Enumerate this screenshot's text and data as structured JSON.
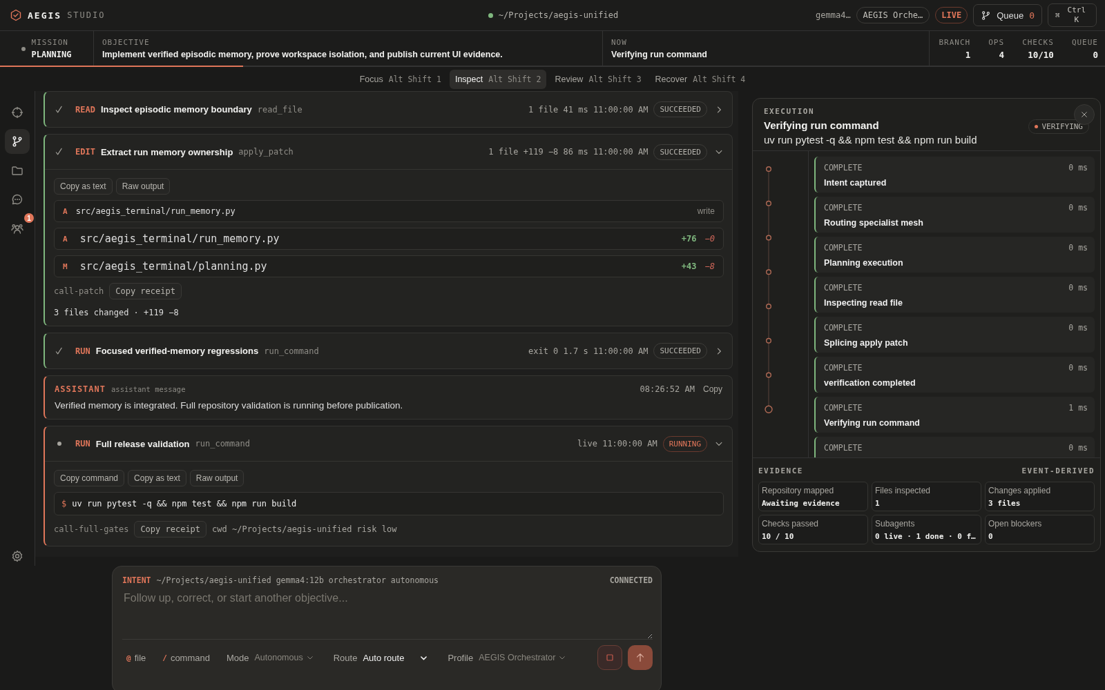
{
  "app": {
    "name": "AEGIS",
    "edition": "STUDIO"
  },
  "workspace": {
    "path": "~/Projects/aegis-unified"
  },
  "header_right": {
    "model": "gemma4…",
    "profile": "AEGIS Orche…",
    "live": "LIVE",
    "queue": {
      "label": "Queue",
      "count": "0"
    },
    "shortcut": {
      "symbol": "⌘",
      "keys": "Ctrl K"
    }
  },
  "mission_bar": {
    "mission_label": "MISSION",
    "mission": "PLANNING",
    "objective_label": "OBJECTIVE",
    "objective": "Implement verified episodic memory, prove workspace isolation, and publish current UI evidence.",
    "now_label": "NOW",
    "now": "Verifying run command",
    "progress": {
      "level": 0.22
    },
    "stats": [
      {
        "label": "BRANCH",
        "value": "1"
      },
      {
        "label": "OPS",
        "value": "4"
      },
      {
        "label": "CHECKS",
        "value": "10/10"
      },
      {
        "label": "QUEUE",
        "value": "0"
      }
    ]
  },
  "modes": [
    {
      "label": "Focus",
      "shortcut": "Alt Shift 1",
      "selected": false
    },
    {
      "label": "Inspect",
      "shortcut": "Alt Shift 2",
      "selected": true
    },
    {
      "label": "Review",
      "shortcut": "Alt Shift 3",
      "selected": false
    },
    {
      "label": "Recover",
      "shortcut": "Alt Shift 4",
      "selected": false
    }
  ],
  "rail": {
    "items": [
      {
        "kind": "crosshair",
        "selected": false
      },
      {
        "kind": "branch",
        "selected": true
      },
      {
        "kind": "folder",
        "selected": false
      },
      {
        "kind": "chat",
        "selected": false
      },
      {
        "kind": "people",
        "selected": false,
        "badge": "1"
      }
    ],
    "footer": {
      "kind": "settings"
    }
  },
  "feed": [
    {
      "kind": "tool",
      "running": false,
      "verb": "READ",
      "title": "Inspect episodic memory boundary",
      "tool": "read_file",
      "meta": "1 file 41 ms 11:00:00 AM",
      "badge": "SUCCEEDED",
      "expanded": false
    },
    {
      "kind": "tool",
      "running": false,
      "verb": "EDIT",
      "title": "Extract run memory ownership",
      "tool": "apply_patch",
      "meta": "1 file +119 −8 86 ms 11:00:00 AM",
      "badge": "SUCCEEDED",
      "expanded": true,
      "actions": [
        "Copy as text",
        "Raw output"
      ],
      "changes": [
        {
          "kind": "op",
          "op": "A",
          "path": "src/aegis_terminal/run_memory.py",
          "note": "write"
        },
        {
          "kind": "diff",
          "op": "A",
          "path": "src/aegis_terminal/run_memory.py",
          "added": "+76",
          "removed": "−0"
        },
        {
          "kind": "diff",
          "op": "M",
          "path": "src/aegis_terminal/planning.py",
          "added": "+43",
          "removed": "−8"
        }
      ],
      "receipt": {
        "id": "call-patch",
        "button": "Copy receipt"
      },
      "summary": "3 files changed · +119 −8"
    },
    {
      "kind": "tool",
      "running": false,
      "verb": "RUN",
      "title": "Focused verified-memory regressions",
      "tool": "run_command",
      "meta": "exit 0 1.7 s 11:00:00 AM",
      "badge": "SUCCEEDED",
      "expanded": false
    },
    {
      "kind": "message",
      "role": "ASSISTANT",
      "label": "assistant message",
      "time": "08:26:52 AM",
      "action": "Copy",
      "text": "Verified memory is integrated. Full repository validation is running before publication."
    },
    {
      "kind": "tool",
      "running": true,
      "verb": "RUN",
      "title": "Full release validation",
      "tool": "run_command",
      "meta": "live 11:00:00 AM",
      "badge": "RUNNING",
      "expanded": true,
      "actions": [
        "Copy command",
        "Copy as text",
        "Raw output"
      ],
      "command": {
        "prompt": "$",
        "text": "uv run pytest -q && npm test && npm run build"
      },
      "receipt": {
        "id": "call-full-gates",
        "button": "Copy receipt",
        "detail": "cwd ~/Projects/aegis-unified risk low"
      }
    }
  ],
  "execution": {
    "label": "EXECUTION",
    "title": "Verifying run command",
    "command": "uv run pytest -q && npm test && npm run build",
    "badge": "VERIFYING",
    "steps": [
      {
        "status": "COMPLETE",
        "duration": "0 ms",
        "title": "Intent captured"
      },
      {
        "status": "COMPLETE",
        "duration": "0 ms",
        "title": "Routing specialist mesh"
      },
      {
        "status": "COMPLETE",
        "duration": "0 ms",
        "title": "Planning execution"
      },
      {
        "status": "COMPLETE",
        "duration": "0 ms",
        "title": "Inspecting read file"
      },
      {
        "status": "COMPLETE",
        "duration": "0 ms",
        "title": "Splicing apply patch"
      },
      {
        "status": "COMPLETE",
        "duration": "0 ms",
        "title": "verification completed"
      },
      {
        "status": "COMPLETE",
        "duration": "1 ms",
        "title": "Verifying run command"
      },
      {
        "status": "COMPLETE",
        "duration": "0 ms"
      }
    ],
    "evidence": {
      "label": "EVIDENCE",
      "source": "EVENT-DERIVED",
      "cells": [
        {
          "label": "Repository mapped",
          "value": "Awaiting evidence"
        },
        {
          "label": "Files inspected",
          "value": "1"
        },
        {
          "label": "Changes applied",
          "value": "3 files"
        },
        {
          "label": "Checks passed",
          "value": "10 / 10"
        },
        {
          "label": "Subagents",
          "value": "0 live · 1 done · 0 f…"
        },
        {
          "label": "Open blockers",
          "value": "0"
        }
      ]
    }
  },
  "composer": {
    "label": "INTENT",
    "context": "~/Projects/aegis-unified gemma4:12b orchestrator autonomous",
    "status": "CONNECTED",
    "placeholder": "Follow up, correct, or start another objective...",
    "tools": [
      {
        "prefix": "@",
        "label": "file"
      },
      {
        "prefix": "/",
        "label": "command"
      }
    ],
    "selects": [
      {
        "kind": "menu",
        "label": "Mode",
        "value": "Autonomous"
      },
      {
        "kind": "native",
        "label": "Route",
        "value": "Auto route"
      },
      {
        "kind": "menu",
        "label": "Profile",
        "value": "AEGIS Orchestrator"
      }
    ]
  }
}
